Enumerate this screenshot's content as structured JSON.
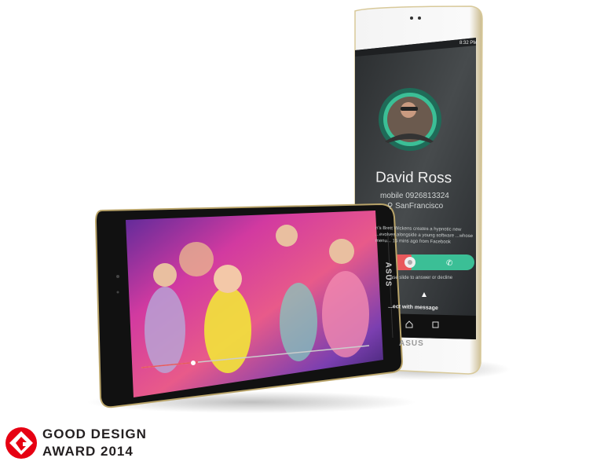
{
  "white_tablet": {
    "status_time": "8:32 PM",
    "caller_name": "David Ross",
    "caller_number": "mobile 0926813324",
    "caller_location": "SanFrancisco",
    "notification": "n's Brett Wickens creates a hypnotic new ...evolves alongside a young software ...whose menu... 15 mins ago from Facebook",
    "slide_hint": "...ase slide to answer or decline",
    "reject_message": "...ect with message",
    "brand": "ASUS"
  },
  "black_tablet": {
    "brand": "ASUS",
    "video_progress": 0.25
  },
  "award": {
    "line1": "GOOD DESIGN",
    "line2": "AWARD 2014"
  },
  "colors": {
    "accent_green": "#3bbf96",
    "decline_red": "#e9595c",
    "award_red": "#e60012"
  }
}
